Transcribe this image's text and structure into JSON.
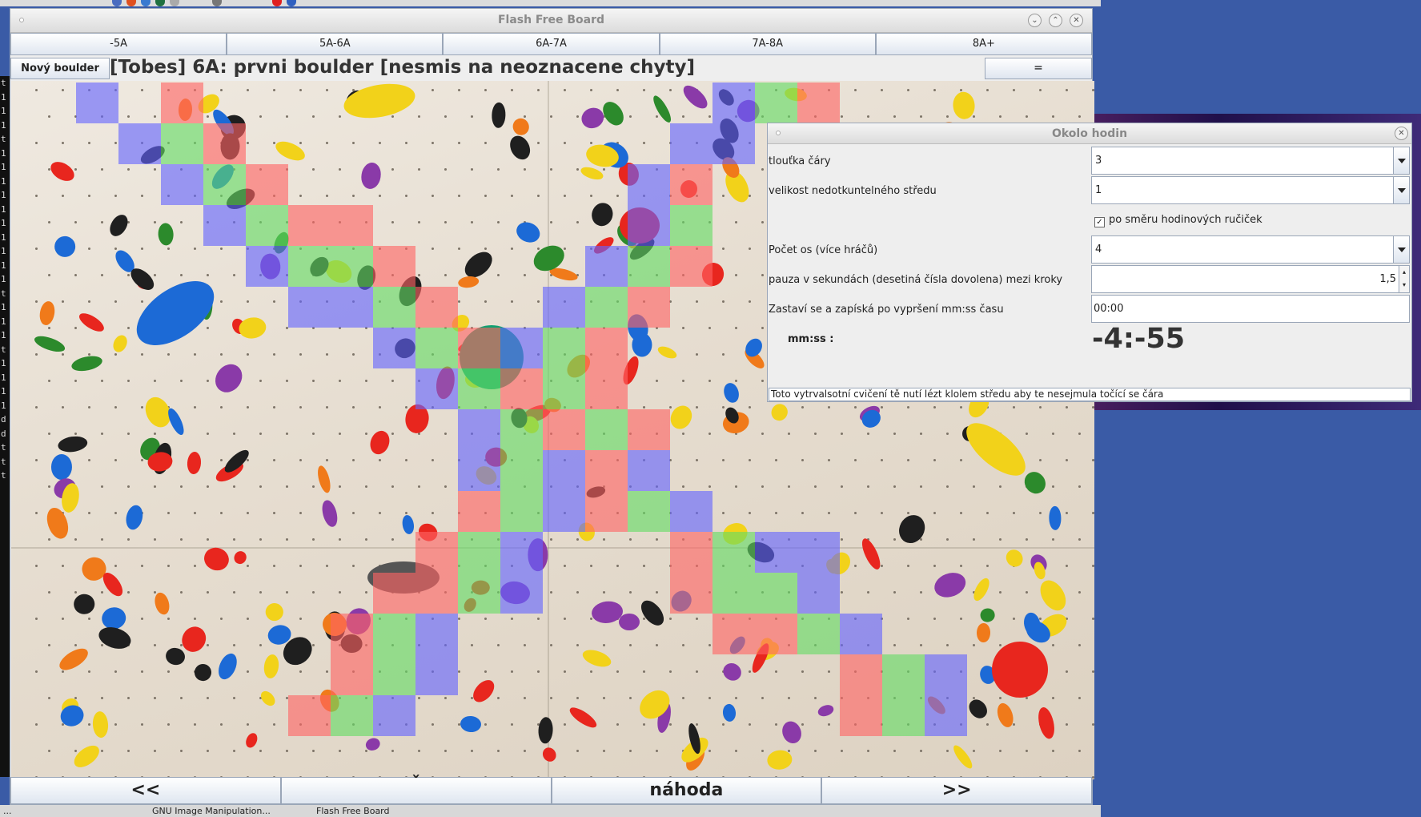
{
  "main_window": {
    "title": "Flash Free Board",
    "grade_tabs": [
      "-5A",
      "5A-6A",
      "6A-7A",
      "7A-8A",
      "8A+"
    ],
    "new_boulder_label": "Nový boulder",
    "boulder_title": "[Tobes] 6A: prvni boulder [nesmis na neoznacene chyty]",
    "eq_button_label": "=",
    "nav": {
      "prev_label": "<<",
      "down_label": "ˇ",
      "random_label": "náhoda",
      "next_label": ">>"
    }
  },
  "dialog": {
    "title": "Okolo hodin",
    "line_width": {
      "label": "tlouťka čáry",
      "value": "3"
    },
    "center_size": {
      "label": "velikost nedotkuntelného středu",
      "value": "1"
    },
    "clockwise": {
      "label": "po směru hodinových ručiček",
      "checked": true
    },
    "axes": {
      "label": "Počet os (více hráčů)",
      "value": "4"
    },
    "pause": {
      "label": "pauza v sekundách (desetiná čísla dovolena) mezi kroky",
      "value": "1,5"
    },
    "stop_after": {
      "label": "Zastaví se a zapíská po  vypršení mm:ss času",
      "value": "00:00"
    },
    "timer": {
      "label": "mm:ss :",
      "value": "-4:-55"
    },
    "status": "Toto vytrvalsotní cvičení tě nutí lézt klolem středu aby te nesejmula točící se čára"
  },
  "terminal_lines": [
    "t",
    "1",
    "1",
    "1",
    "t",
    "1",
    "1",
    "1",
    "1",
    "1",
    "1",
    "1",
    "1",
    "1",
    "1",
    "t",
    "1",
    "1",
    "1",
    "t",
    "1",
    "1",
    "1",
    "1",
    "d",
    "d",
    "t",
    "t",
    "t"
  ],
  "taskbar": {
    "items": [
      "...",
      "GNU Image Manipulation...",
      "Flash Free Board"
    ]
  },
  "colors": {
    "cell_red": "#ff6464",
    "cell_green": "#64dc64",
    "cell_blue": "#6464ff",
    "window_bg": "#eeeeee",
    "desktop": "#3a5ba6"
  }
}
